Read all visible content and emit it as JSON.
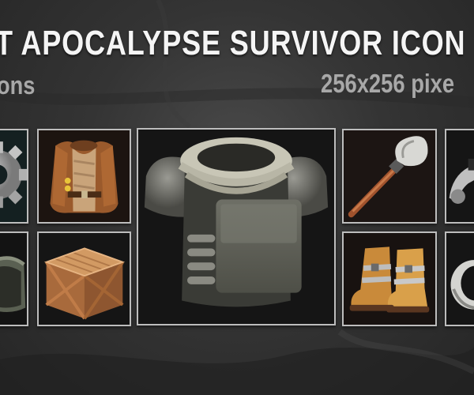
{
  "banner": {
    "title": "T APOCALYPSE SURVIVOR ICON",
    "subtitle_left": "ons",
    "subtitle_right": "256x256  pixe"
  },
  "icons": [
    {
      "name": "gear-icon"
    },
    {
      "name": "leather-vest-icon"
    },
    {
      "name": "body-armor-icon"
    },
    {
      "name": "shovel-icon"
    },
    {
      "name": "tool-icon"
    },
    {
      "name": "helmet-icon"
    },
    {
      "name": "wooden-crate-icon"
    },
    {
      "name": "boots-icon"
    },
    {
      "name": "ring-icon"
    }
  ],
  "colors": {
    "background": "#343434",
    "tile_border": "#bdbdbd",
    "title_text": "#f5f5f5",
    "subtitle_text": "#a8a8a8"
  }
}
